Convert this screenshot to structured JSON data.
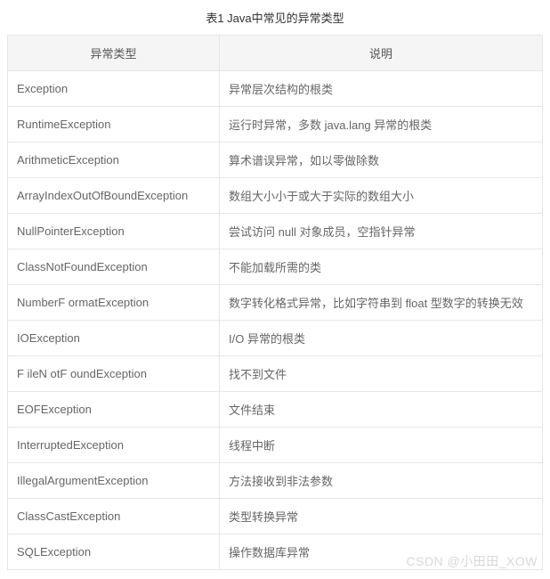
{
  "caption": "表1 Java中常见的异常类型",
  "headers": {
    "type": "异常类型",
    "desc": "说明"
  },
  "rows": [
    {
      "type": "Exception",
      "desc": "异常层次结构的根类"
    },
    {
      "type": "RuntimeException",
      "desc": "运行时异常，多数 java.lang 异常的根类"
    },
    {
      "type": "ArithmeticException",
      "desc": "算术谱误异常，如以零做除数"
    },
    {
      "type": "ArrayIndexOutOfBoundException",
      "desc": "数组大小小于或大于实际的数组大小"
    },
    {
      "type": "NullPointerException",
      "desc": "尝试访问 null 对象成员，空指针异常"
    },
    {
      "type": "ClassNotFoundException",
      "desc": "不能加载所需的类"
    },
    {
      "type": "NumberF ormatException",
      "desc": "数字转化格式异常，比如字符串到 float 型数字的转换无效"
    },
    {
      "type": "IOException",
      "desc": "I/O 异常的根类"
    },
    {
      "type": "F ileN otF oundException",
      "desc": "找不到文件"
    },
    {
      "type": "EOFException",
      "desc": "文件结束"
    },
    {
      "type": "InterruptedException",
      "desc": "线程中断"
    },
    {
      "type": "IllegalArgumentException",
      "desc": "方法接收到非法参数"
    },
    {
      "type": "ClassCastException",
      "desc": "类型转换异常"
    },
    {
      "type": "SQLException",
      "desc": "操作数据库异常"
    }
  ],
  "watermark": "CSDN @小田田_XOW"
}
